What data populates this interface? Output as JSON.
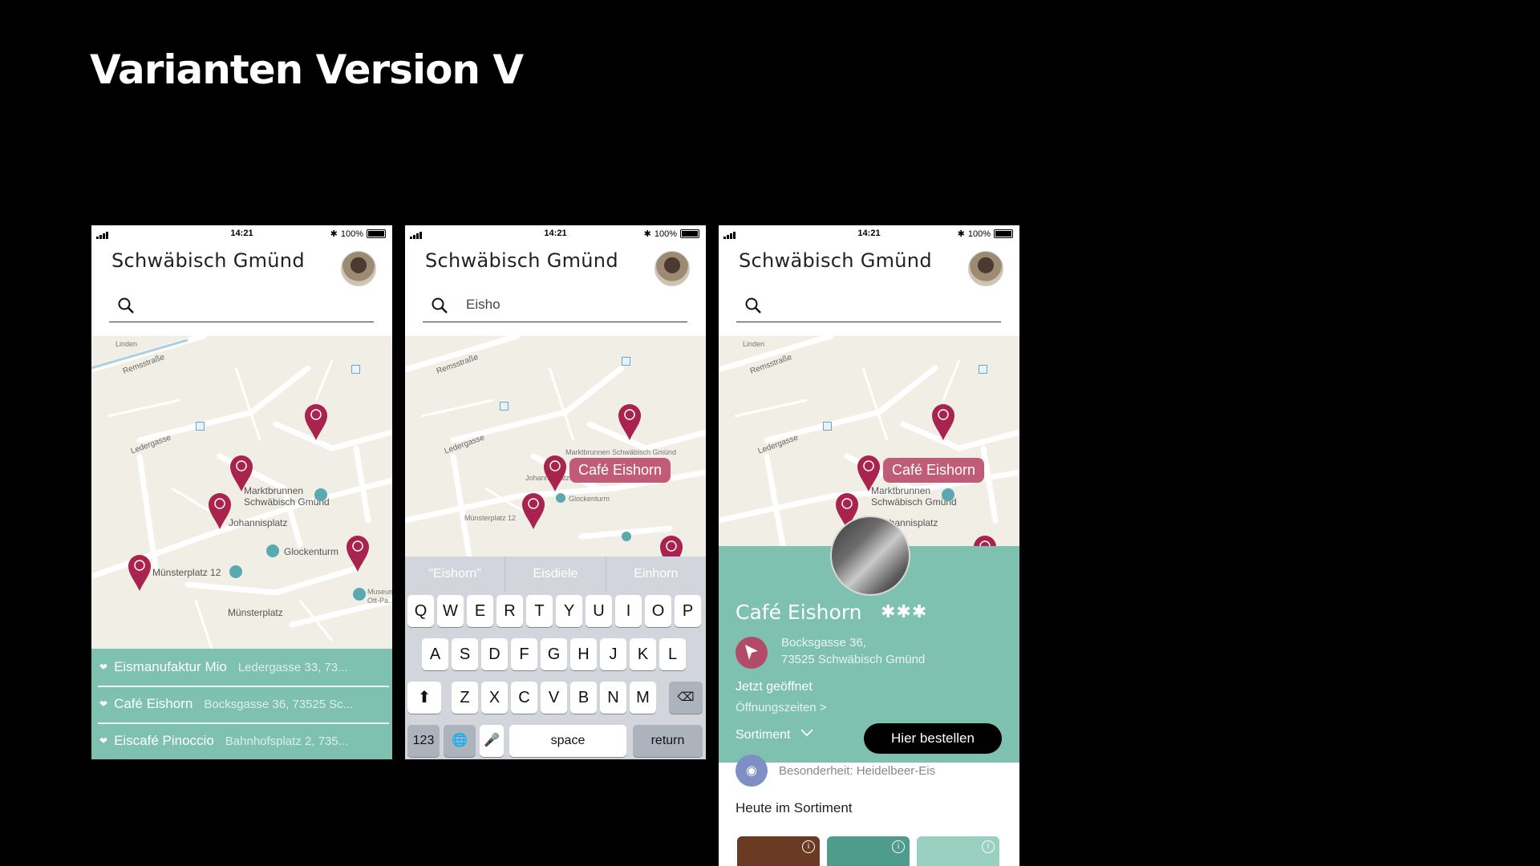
{
  "slide": {
    "title": "Varianten Version V"
  },
  "status": {
    "time": "14:21",
    "battery": "100%"
  },
  "app": {
    "title": "Schwäbisch Gmünd"
  },
  "search": {
    "query": "Eisho"
  },
  "map_labels": {
    "remsstrasse": "Remsstraße",
    "ledergasse": "Ledergasse",
    "linden": "Linden",
    "marktbrunnen": "Marktbrunnen\nSchwäbisch Gmünd",
    "johannisplatz": "Johannisplatz",
    "glockenturm": "Glockenturm",
    "muensterplatz12": "Münsterplatz 12",
    "muensterplatz": "Münsterplatz",
    "museum": "Museum\nOtt-Pa..."
  },
  "results": [
    {
      "name": "Eismanufaktur Mio",
      "address": "Ledergasse 33, 73..."
    },
    {
      "name": "Café Eishorn",
      "address": "Bocksgasse 36, 73525 Sc..."
    },
    {
      "name": "Eiscafé Pinoccio",
      "address": "Bahnhofsplatz 2, 735..."
    }
  ],
  "callout": "Café Eishorn",
  "keyboard": {
    "suggestions": [
      "\"Eishorn\"",
      "Eisdiele",
      "Einhorn"
    ],
    "row1": [
      "Q",
      "W",
      "E",
      "R",
      "T",
      "Y",
      "U",
      "I",
      "O",
      "P"
    ],
    "row2": [
      "A",
      "S",
      "D",
      "F",
      "G",
      "H",
      "J",
      "K",
      "L"
    ],
    "row3": [
      "Z",
      "X",
      "C",
      "V",
      "B",
      "N",
      "M"
    ],
    "numbers_key": "123",
    "space_key": "space",
    "return_key": "return"
  },
  "detail": {
    "name": "Café Eishorn",
    "rating": "✱✱✱",
    "address_line1": "Bocksgasse 36,",
    "address_line2": "73525 Schwäbisch Gmünd",
    "open_status": "Jetzt geöffnet",
    "hours_link": "Öffnungszeiten >",
    "range_label": "Sortiment",
    "order_button": "Hier bestellen",
    "special": "Besonderheit: Heidelbeer-Eis",
    "today_heading": "Heute im Sortiment"
  },
  "colors": {
    "pin": "#a8244f",
    "teal": "#7fc1b0",
    "callout": "#c05c77"
  }
}
